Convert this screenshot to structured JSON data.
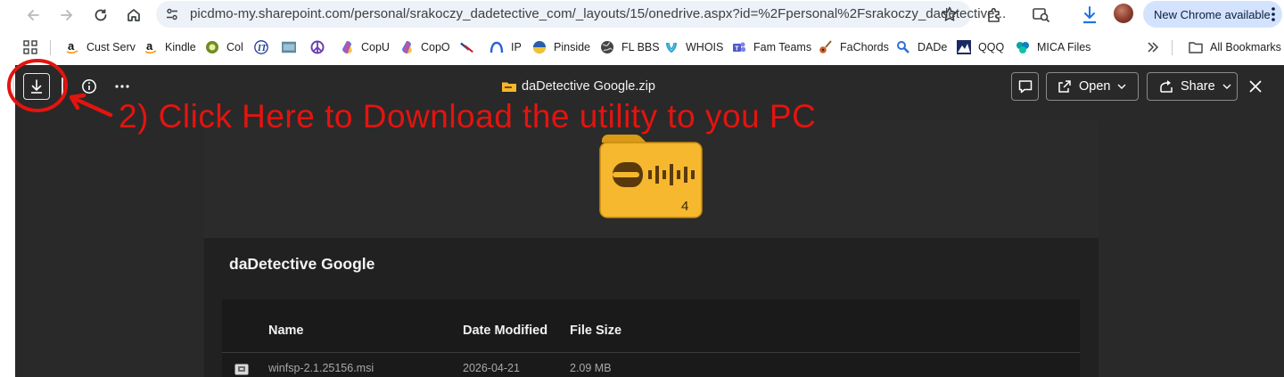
{
  "browser": {
    "url": "picdmo-my.sharepoint.com/personal/srakoczy_dadetective_com/_layouts/15/onedrive.aspx?id=%2Fpersonal%2Fsrakoczy_dadetective...",
    "update_label": "New Chrome available",
    "icons": [
      "back-icon",
      "forward-icon",
      "reload-icon",
      "home-icon",
      "site-settings-icon",
      "bookmark-star-icon",
      "extensions-icon",
      "lens-icon",
      "download-icon",
      "profile-avatar",
      "more-vert-icon"
    ]
  },
  "bookmarks": {
    "items": [
      {
        "label": "Cust Serv",
        "icon": "amazon-icon"
      },
      {
        "label": "Kindle",
        "icon": "amazon-icon"
      },
      {
        "label": "Col",
        "icon": "col-icon"
      },
      {
        "label": "",
        "icon": "italic-icon"
      },
      {
        "label": "",
        "icon": "image-icon"
      },
      {
        "label": "",
        "icon": "peace-icon"
      },
      {
        "label": "CopU",
        "icon": "copilot-icon"
      },
      {
        "label": "CopO",
        "icon": "copilot-icon"
      },
      {
        "label": "",
        "icon": "airline-icon"
      },
      {
        "label": "IP",
        "icon": "arc-icon"
      },
      {
        "label": "Pinside",
        "icon": "pinside-icon"
      },
      {
        "label": "FL BBS",
        "icon": "globe-icon"
      },
      {
        "label": "WHOIS",
        "icon": "whois-icon"
      },
      {
        "label": "Fam Teams",
        "icon": "teams-icon"
      },
      {
        "label": "FaChords",
        "icon": "guitar-icon"
      },
      {
        "label": "DADe",
        "icon": "dade-icon"
      },
      {
        "label": "QQQ",
        "icon": "qqq-icon"
      },
      {
        "label": "MICA Files",
        "icon": "mica-icon"
      }
    ],
    "overflow_icon": "chevron-double-right-icon",
    "all_bookmarks": "All Bookmarks"
  },
  "viewer": {
    "file_title": "daDetective Google.zip",
    "open_label": "Open",
    "share_label": "Share",
    "annotation": "2)  Click Here to Download the utility to you PC",
    "folder_badge": "4",
    "folder_name": "daDetective Google",
    "columns": [
      "Name",
      "Date Modified",
      "File Size"
    ],
    "rows": [
      {
        "name": "winfsp-2.1.25156.msi",
        "date": "2026-04-21",
        "size": "2.09 MB"
      }
    ],
    "colors": {
      "annotation": "#e3140f",
      "folder": "#f5b82e",
      "background": "#292929"
    }
  }
}
